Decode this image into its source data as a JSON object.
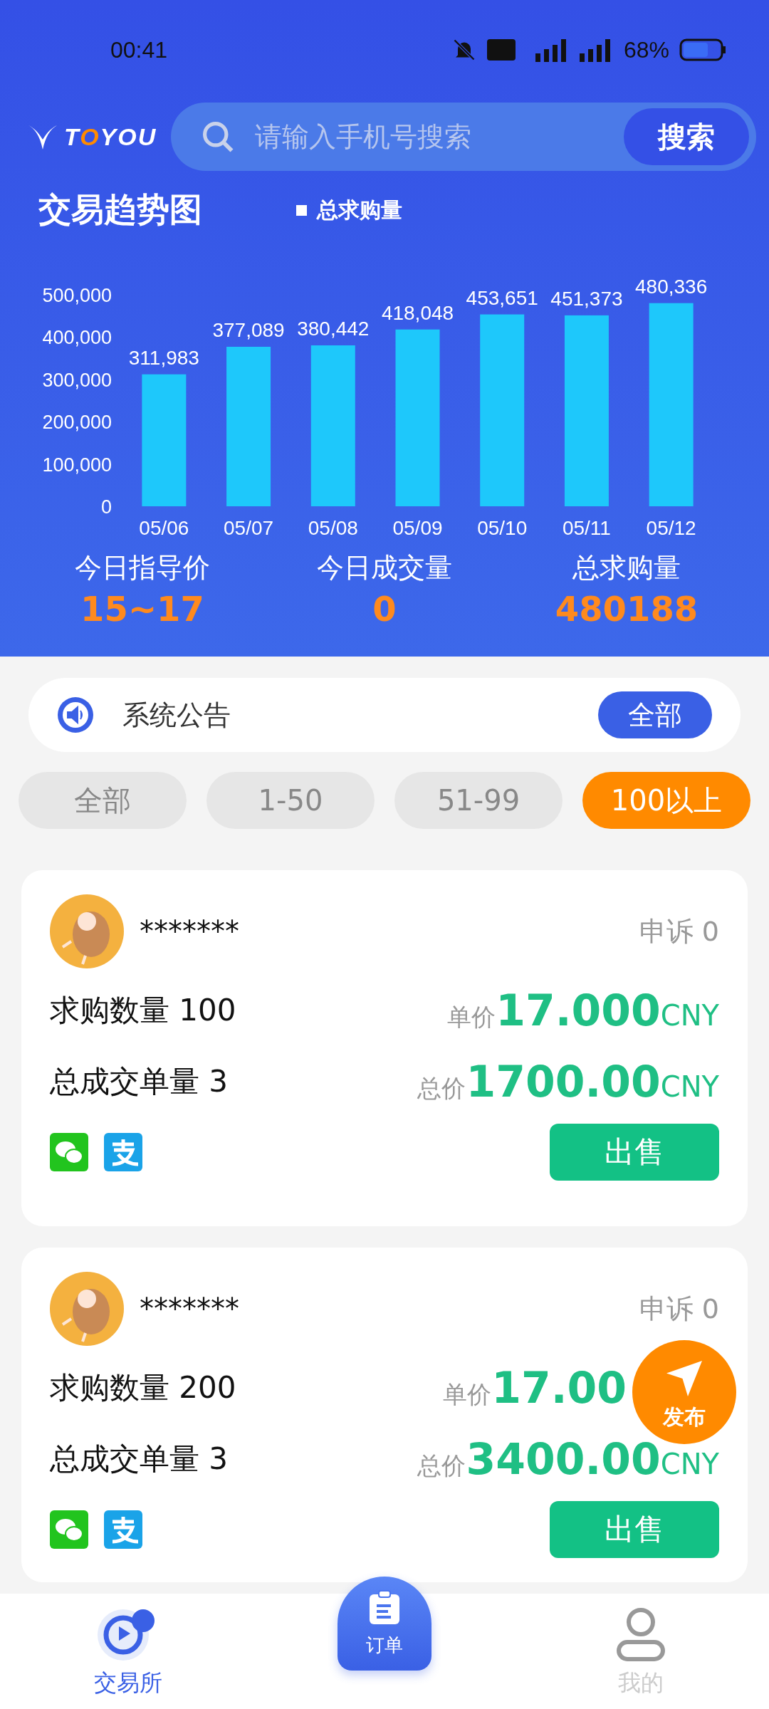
{
  "status_bar": {
    "time": "00:41",
    "battery": "68%"
  },
  "header": {
    "logo": [
      {
        "text": "T",
        "accent": false
      },
      {
        "text": "O",
        "accent": true
      },
      {
        "text": "YOU",
        "accent": false
      }
    ],
    "search": {
      "placeholder": "请输入手机号搜索",
      "button": "搜索"
    }
  },
  "trend": {
    "title": "交易趋势图",
    "chart_data": {
      "type": "bar",
      "categories": [
        "05/06",
        "05/07",
        "05/08",
        "05/09",
        "05/10",
        "05/11",
        "05/12"
      ],
      "series": [
        {
          "name": "总求购量",
          "color": "#1ec8fb",
          "values": [
            311983,
            377089,
            380442,
            418048,
            453651,
            451373,
            480336
          ]
        }
      ],
      "ylim": [
        0,
        500000
      ],
      "yticks": [
        {
          "value": 0,
          "label": "0"
        },
        {
          "value": 100000,
          "label": "100,000"
        },
        {
          "value": 200000,
          "label": "200,000"
        },
        {
          "value": 300000,
          "label": "300,000"
        },
        {
          "value": 400000,
          "label": "400,000"
        },
        {
          "value": 500000,
          "label": "500,000"
        }
      ],
      "value_labels": [
        "311,983",
        "377,089",
        "380,442",
        "418,048",
        "453,651",
        "451,373",
        "480,336"
      ]
    }
  },
  "stats": [
    {
      "label": "今日指导价",
      "value": "15~17"
    },
    {
      "label": "今日成交量",
      "value": "0"
    },
    {
      "label": "总求购量",
      "value": "480188"
    }
  ],
  "notice": {
    "label": "系统公告",
    "button": "全部"
  },
  "filters": [
    {
      "label": "全部",
      "selected": false
    },
    {
      "label": "1-50",
      "selected": false
    },
    {
      "label": "51-99",
      "selected": false
    },
    {
      "label": "100以上",
      "selected": true
    }
  ],
  "orders": [
    {
      "name": "*******",
      "appeal": "申诉 0",
      "quantity": "求购数量 100",
      "deals": "总成交单量 3",
      "unit_label": "单价",
      "unit_price": "17.000",
      "unit_currency": "CNY",
      "total_label": "总价",
      "total_price": "1700.00",
      "total_currency": "CNY",
      "button": "出售"
    },
    {
      "name": "*******",
      "appeal": "申诉 0",
      "quantity": "求购数量 200",
      "deals": "总成交单量 3",
      "unit_label": "单价",
      "unit_price": "17.00",
      "total_label": "总价",
      "total_price": "3400.00",
      "total_currency": "CNY",
      "button": "出售"
    }
  ],
  "fab": {
    "label": "发布"
  },
  "nav": [
    {
      "label": "交易所",
      "kind": "tab",
      "selected": true
    },
    {
      "label": "订单",
      "kind": "center",
      "selected": false
    },
    {
      "label": "我的",
      "kind": "tab",
      "selected": false
    }
  ]
}
